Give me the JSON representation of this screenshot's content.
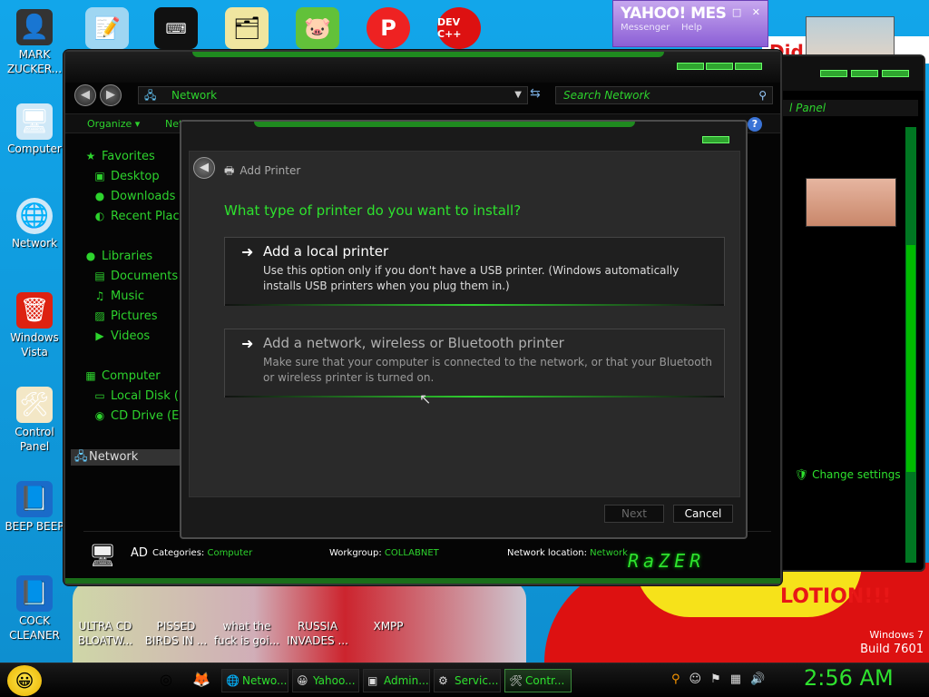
{
  "desktop": {
    "left_icons": [
      {
        "name": "mark-icon",
        "label": "MARK ZUCKER...",
        "glyph": "👤"
      },
      {
        "name": "computer-icon",
        "label": "Computer",
        "glyph": "🖥"
      },
      {
        "name": "network-icon",
        "label": "Network",
        "glyph": "🌐"
      },
      {
        "name": "recycle-bin-icon",
        "label": "Windows Vista",
        "glyph": "🗑"
      },
      {
        "name": "control-panel-icon",
        "label": "Control Panel",
        "glyph": "🛠"
      },
      {
        "name": "beep-icon",
        "label": "BEEP BEEP",
        "glyph": "📘"
      },
      {
        "name": "cock-cleaner-icon",
        "label": "COCK CLEANER",
        "glyph": "📘"
      }
    ],
    "bottom_icons": [
      {
        "label": "ULTRA CD BLOATW..."
      },
      {
        "label": "PISSED BIRDS IN ..."
      },
      {
        "label": "what the fuck is goi..."
      },
      {
        "label": "RUSSIA INVADES ..."
      },
      {
        "label": "XMPP"
      }
    ],
    "top_icons": [
      {
        "glyph": "📝"
      },
      {
        "glyph": "⌨"
      },
      {
        "glyph": "🗂"
      },
      {
        "glyph": "🐷"
      },
      {
        "glyph": "P"
      },
      {
        "glyph": "DEV C++"
      }
    ],
    "wall_did": "Did you",
    "wall_text": "LOTION!!!",
    "watermark_os": "Windows 7",
    "watermark_build": "Build 7601"
  },
  "yahoo": {
    "title": "YAHOO! MES",
    "sub_messenger": "Messenger",
    "sub_help": "Help",
    "buttons": "– □ ✕"
  },
  "back_window": {
    "search_text": "l Panel",
    "change_settings": "Change settings"
  },
  "explorer": {
    "address": "Network",
    "search_placeholder": "Search Network",
    "organize": "Organize",
    "network_cmd": "Netw",
    "nav": {
      "favorites": "Favorites",
      "desktop": "Desktop",
      "downloads": "Downloads",
      "recent": "Recent Plac",
      "libraries": "Libraries",
      "documents": "Documents",
      "music": "Music",
      "pictures": "Pictures",
      "videos": "Videos",
      "computer": "Computer",
      "local_disk": "Local Disk (",
      "cd_drive": "CD Drive (E",
      "network": "Network"
    },
    "status": {
      "name": "AD",
      "categories_label": "Categories:",
      "categories_value": "Computer",
      "workgroup_label": "Workgroup:",
      "workgroup_value": "COLLABNET",
      "location_label": "Network location:",
      "location_value": "Network",
      "brand": "RaZER"
    }
  },
  "dialog": {
    "title": "Add Printer",
    "question": "What type of printer do you want to install?",
    "option1_title": "Add a local printer",
    "option1_desc": "Use this option only if you don't have a USB printer. (Windows automatically installs USB printers when you plug them in.)",
    "option2_title": "Add a network, wireless or Bluetooth printer",
    "option2_desc": "Make sure that your computer is connected to the network, or that your Bluetooth or wireless printer is turned on.",
    "next": "Next",
    "cancel": "Cancel"
  },
  "taskbar": {
    "buttons": [
      {
        "icon": "🌐",
        "label": "Netwo..."
      },
      {
        "icon": "😀",
        "label": "Yahoo..."
      },
      {
        "icon": "▣",
        "label": "Admin..."
      },
      {
        "icon": "⚙",
        "label": "Servic..."
      },
      {
        "icon": "🛠",
        "label": "Contr..."
      }
    ],
    "clock": "2:56 AM"
  }
}
